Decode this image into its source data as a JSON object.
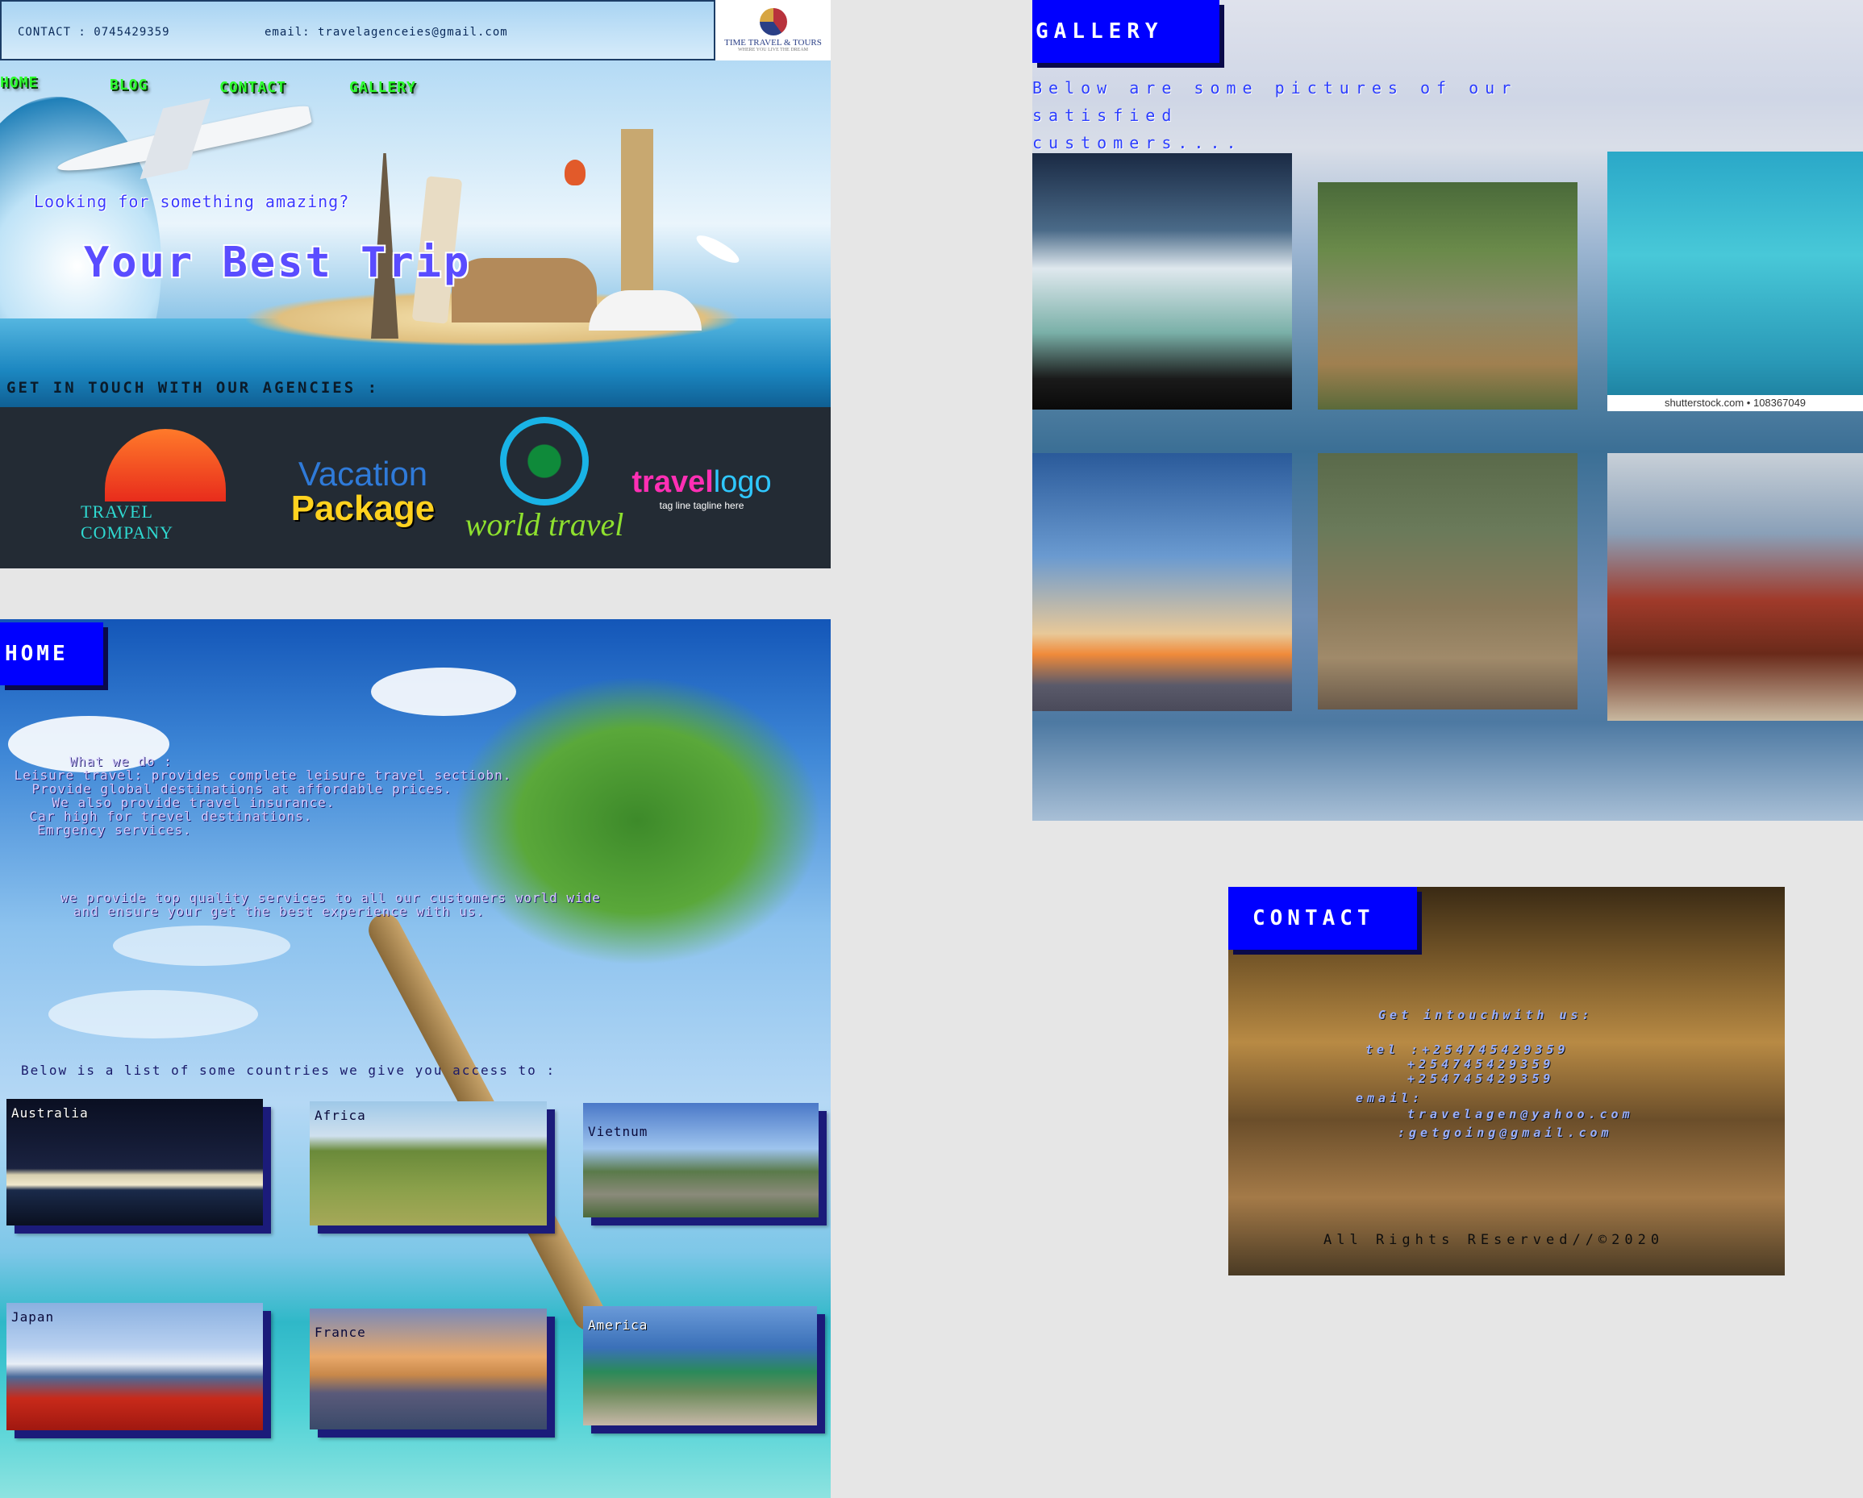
{
  "header": {
    "contact_text": "CONTACT : 0745429359",
    "email_text": "email: travelagenceies@gmail.com",
    "logo_title": "TIME TRAVEL & TOURS",
    "logo_sub": "WHERE YOU LIVE THE DREAM"
  },
  "nav": [
    "HOME",
    "BLOG",
    "CONTACT",
    "GALLERY"
  ],
  "hero": {
    "tagline": "Looking for something amazing?",
    "title": "Your Best Trip",
    "touch": "GET IN TOUCH WITH OUR AGENCIES :"
  },
  "agencies": {
    "a1": "TRAVEL COMPANY",
    "a2_l1": "Vacation",
    "a2_l2": "Package",
    "a3": "world travel",
    "a4_a": "travel",
    "a4_b": "logo",
    "a4_sub": "tag line tagline here"
  },
  "home": {
    "badge": "HOME",
    "lines": [
      "What we do :",
      "Leisure travel: provides complete leisure travel sectiobn.",
      "Provide global destinations at affordable prices.",
      "We also provide travel insurance.",
      "Car high for trevel destinations.",
      "Emrgency services."
    ],
    "quality_1": "we provide top quality  services to all our customers world wide",
    "quality_2": "and ensure your get the best experience with us.",
    "list_title": "Below is a list of some countries we give you access to :",
    "countries": [
      "Australia",
      "Africa",
      "Vietnum",
      "Japan",
      "France",
      "America"
    ]
  },
  "gallery": {
    "badge": "GALLERY",
    "desc_1": "Below are some pictures  of our satisfied",
    "desc_2": "customers....",
    "shutter": "shutterstock.com • 108367049"
  },
  "contact": {
    "badge": "CONTACT",
    "title": "Get intouchwith us:",
    "tel_1": "tel :+254745429359",
    "tel_2": "+254745429359",
    "tel_3": "+254745429359",
    "email_label": "email:",
    "email_1": "travelagen@yahoo.com",
    "email_2": ":getgoing@gmail.com",
    "footer": "All Rights REserved//©2020"
  }
}
